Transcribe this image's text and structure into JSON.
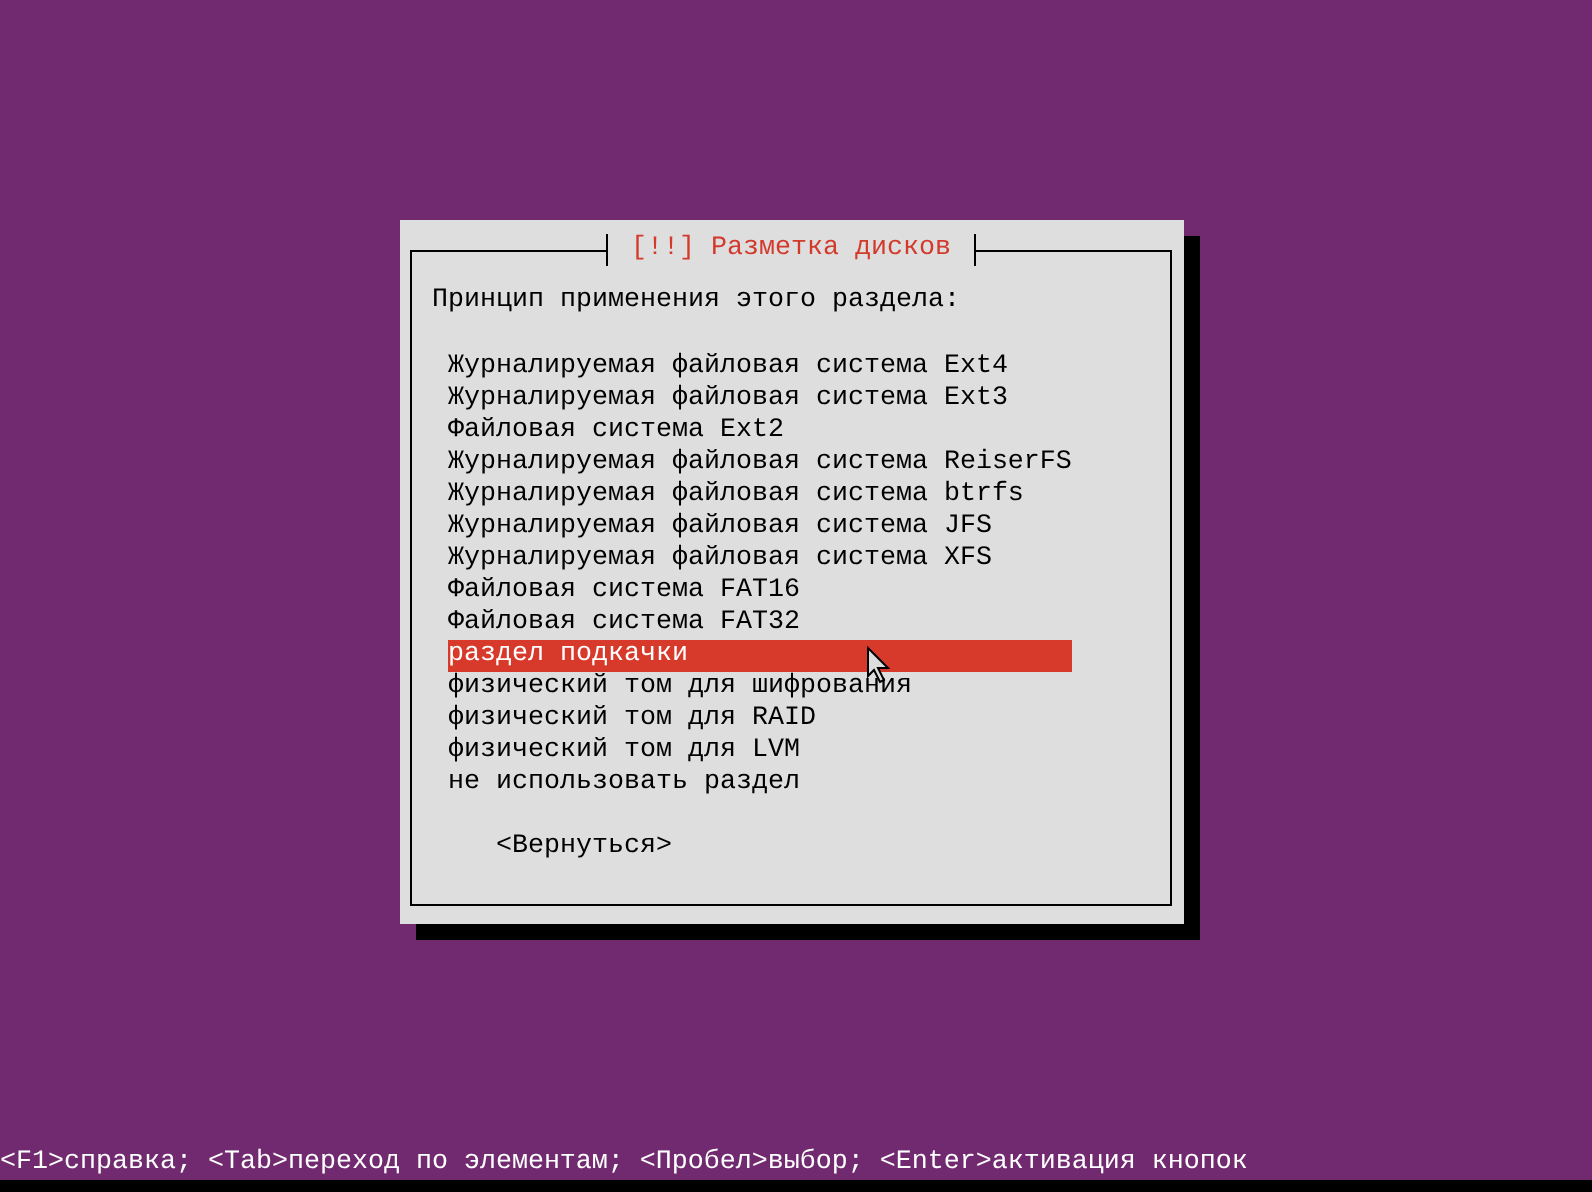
{
  "dialog": {
    "title": "[!!] Разметка дисков",
    "prompt": "Принцип применения этого раздела:",
    "options": [
      {
        "label": "Журналируемая файловая система Ext4",
        "selected": false
      },
      {
        "label": "Журналируемая файловая система Ext3",
        "selected": false
      },
      {
        "label": "Файловая система Ext2",
        "selected": false
      },
      {
        "label": "Журналируемая файловая система ReiserFS",
        "selected": false
      },
      {
        "label": "Журналируемая файловая система btrfs",
        "selected": false
      },
      {
        "label": "Журналируемая файловая система JFS",
        "selected": false
      },
      {
        "label": "Журналируемая файловая система XFS",
        "selected": false
      },
      {
        "label": "Файловая система FAT16",
        "selected": false
      },
      {
        "label": "Файловая система FAT32",
        "selected": false
      },
      {
        "label": "раздел подкачки",
        "selected": true
      },
      {
        "label": "физический том для шифрования",
        "selected": false
      },
      {
        "label": "физический том для RAID",
        "selected": false
      },
      {
        "label": "физический том для LVM",
        "selected": false
      },
      {
        "label": "не использовать раздел",
        "selected": false
      }
    ],
    "back_button": "<Вернуться>"
  },
  "status_bar": "<F1>справка; <Tab>переход по элементам; <Пробел>выбор; <Enter>активация кнопок"
}
